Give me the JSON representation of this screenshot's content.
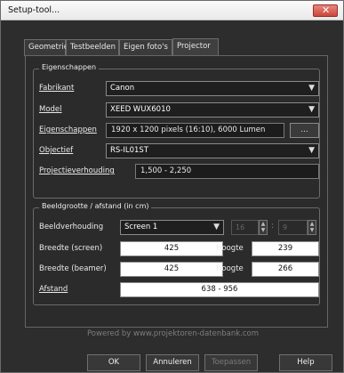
{
  "window": {
    "title": "Setup-tool...",
    "close_glyph": "✕"
  },
  "tabs": [
    {
      "label": "Geometrie"
    },
    {
      "label": "Testbeelden"
    },
    {
      "label": "Eigen foto's"
    },
    {
      "label": "Projector",
      "active": true
    }
  ],
  "properties": {
    "group_title": "Eigenschappen",
    "manufacturer_label": "Fabrikant",
    "manufacturer_value": "Canon",
    "model_label": "Model",
    "model_value": "XEED WUX6010",
    "specs_label": "Eigenschappen",
    "specs_value": "1920 x 1200 pixels (16:10), 6000 Lumen",
    "specs_button": "...",
    "lens_label": "Objectief",
    "lens_value": "RS-IL01ST",
    "throw_ratio_label": "Projectieverhouding",
    "throw_ratio_value": "1,500 - 2,250"
  },
  "image_size": {
    "group_title": "Beeldgrootte / afstand (in cm)",
    "aspect_label": "Beeldverhouding",
    "aspect_value": "Screen 1",
    "aspect_w": "16",
    "aspect_sep": ":",
    "aspect_h": "9",
    "width_screen_label": "Breedte (screen)",
    "width_screen_value": "425",
    "height_label": "Hoogte",
    "height_screen_value": "239",
    "width_beamer_label": "Breedte (beamer)",
    "width_beamer_value": "425",
    "height_beamer_value": "266",
    "distance_label": "Afstand",
    "distance_value": "638 - 956"
  },
  "footer": {
    "powered_by": "Powered by www.projektoren-datenbank.com",
    "ok": "OK",
    "cancel": "Annuleren",
    "apply": "Toepassen",
    "help": "Help"
  },
  "icons": {
    "dropdown": "chevron-down-icon",
    "spin": "spin-arrows-icon"
  },
  "colors": {
    "background": "#2d2d2d",
    "titlebar": "#f0f0f0",
    "close": "#c9453a",
    "field": "#ffffff"
  }
}
